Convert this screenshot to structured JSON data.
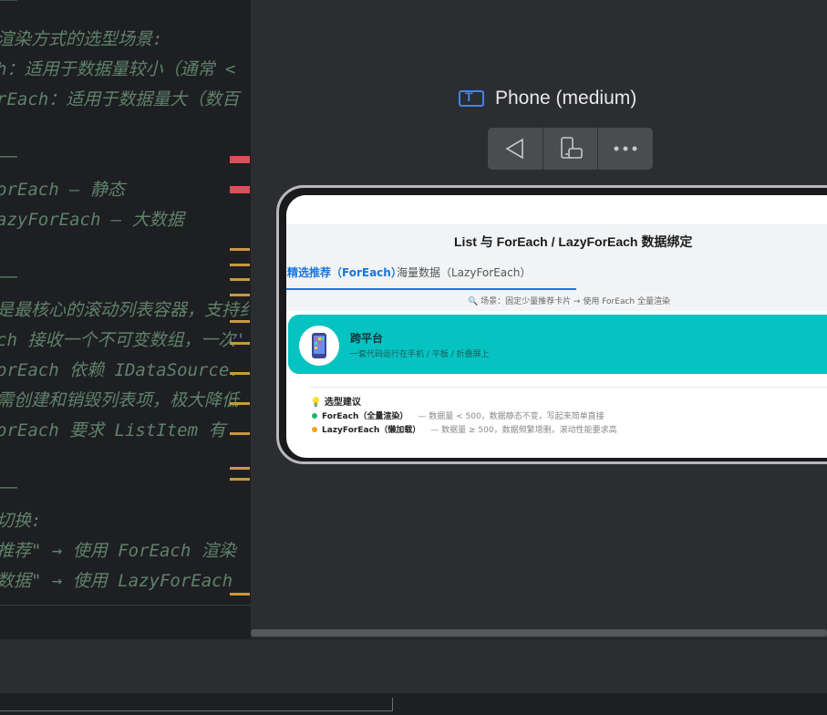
{
  "editor": {
    "lines": [
      "——",
      "渲染方式的选型场景:",
      "h：适用于数据量较小（通常 <",
      "rEach：适用于数据量大（数百",
      "——",
      "orEach        — 静态",
      "azyForEach    — 大数据",
      "——",
      "是最核心的滚动列表容器，支持纟",
      "ch 接收一个不可变数组，一次'",
      "orEach 依赖 IDataSource.",
      "需创建和销毁列表项，极大降低",
      "orEach 要求 ListItem 有",
      "——",
      "切换:",
      "推荐\" → 使用 ForEach 渲染",
      "数据\" → 使用 LazyForEach"
    ]
  },
  "preview": {
    "device_label": "Phone (medium)",
    "icons": {
      "device": "text-frame-icon",
      "back": "back-triangle-icon",
      "rotate": "rotate-device-icon",
      "more": "more-dots-icon"
    }
  },
  "app": {
    "title": "List 与 ForEach / LazyForEach 数据绑定",
    "tabs": [
      {
        "label": "精选推荐（ForEach）"
      },
      {
        "label": "海量数据（LazyForEach）"
      }
    ],
    "scene": "🔍 场景：固定少量推荐卡片 → 使用 ForEach 全量渲染",
    "card": {
      "title": "跨平台",
      "subtitle": "一套代码运行在手机 / 平板 / 折叠屏上"
    },
    "tips": {
      "title": "💡 选型建议",
      "items": [
        {
          "name": "ForEach（全量渲染）",
          "desc": "— 数据量 < 500，数据静态不变，写起来简单直接",
          "color": "#21b36b"
        },
        {
          "name": "LazyForEach（懒加载）",
          "desc": "— 数据量 ≥ 500，数据频繁增删，滚动性能要求高",
          "color": "#f0a21c"
        }
      ]
    }
  },
  "colors": {
    "accent": "#1677e0",
    "card": "#05c3c0",
    "comment": "#5f826b",
    "gutter_warning": "#c79a3e",
    "gutter_error": "#d8505a"
  }
}
